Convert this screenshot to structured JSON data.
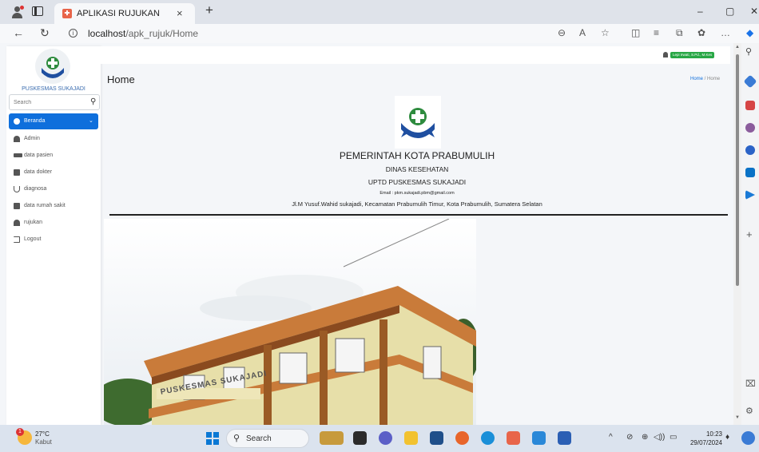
{
  "browser": {
    "tab_title": "APLIKASI RUJUKAN",
    "tab_close": "×",
    "new_tab": "+",
    "url_host": "localhost",
    "url_path": "/apk_rujuk/Home",
    "window_controls": [
      "–",
      "▢",
      "✕"
    ]
  },
  "sidebar": {
    "brand": "PUSKESMAS SUKAJADI",
    "search_placeholder": "Search",
    "items": [
      {
        "label": "Beranda",
        "icon": "palette-icon",
        "active": true
      },
      {
        "label": "Admin",
        "icon": "user-icon",
        "active": false
      },
      {
        "label": "data pasien",
        "icon": "bed-icon",
        "active": false
      },
      {
        "label": "data dokter",
        "icon": "clipboard-icon",
        "active": false
      },
      {
        "label": "diagnosa",
        "icon": "stethoscope-icon",
        "active": false
      },
      {
        "label": "data rumah sakit",
        "icon": "hospital-icon",
        "active": false
      },
      {
        "label": "rujukan",
        "icon": "user-check-icon",
        "active": false
      },
      {
        "label": "Logout",
        "icon": "logout-icon",
        "active": false
      }
    ]
  },
  "header": {
    "user_name": "Lepi Irwati, S.Pd., M.Kes",
    "page_title": "Home",
    "breadcrumb_home": "Home",
    "breadcrumb_sep": " / ",
    "breadcrumb_current": "Home"
  },
  "kop": {
    "line1": "PEMERINTAH KOTA PRABUMULIH",
    "line2": "DINAS KESEHATAN",
    "line3": "UPTD PUSKESMAS SUKAJADI",
    "line4": "Email : pkm.sukajadi.pbm@gmail.com",
    "line5": "Jl.M Yusuf.Wahid sukajadi, Kecamatan Prabumulih Timur, Kota Prabumulih, Sumatera Selatan"
  },
  "photo": {
    "sign_text": "PUSKESMAS SUKAJADI"
  },
  "taskbar": {
    "temperature": "27°C",
    "condition": "Kabut",
    "weather_badge": "1",
    "search_label": "Search",
    "time": "10:23",
    "date": "29/07/2024"
  },
  "colors": {
    "accent": "#0f6fdc",
    "user_badge": "#28a745",
    "brand_text": "#3b6db0"
  }
}
